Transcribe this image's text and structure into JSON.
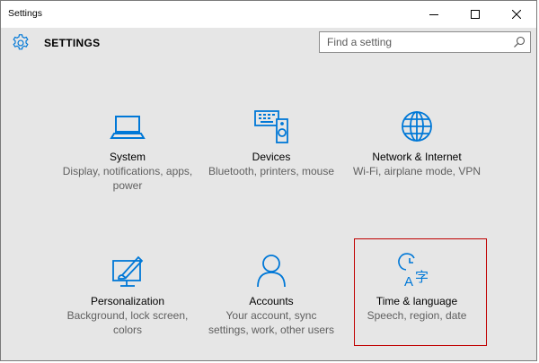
{
  "window": {
    "title": "Settings"
  },
  "header": {
    "heading": "SETTINGS",
    "gear_icon": "gear-icon"
  },
  "search": {
    "placeholder": "Find a setting",
    "icon": "search-icon"
  },
  "colors": {
    "accent": "#0078d7",
    "background": "#e6e6e6",
    "highlight_border": "#c00000"
  },
  "tiles": [
    {
      "label": "System",
      "desc": "Display, notifications, apps, power",
      "icon": "laptop-icon"
    },
    {
      "label": "Devices",
      "desc": "Bluetooth, printers, mouse",
      "icon": "devices-icon"
    },
    {
      "label": "Network & Internet",
      "desc": "Wi-Fi, airplane mode, VPN",
      "icon": "globe-icon"
    },
    {
      "label": "Personalization",
      "desc": "Background, lock screen, colors",
      "icon": "paint-icon"
    },
    {
      "label": "Accounts",
      "desc": "Your account, sync settings, work, other users",
      "icon": "person-icon"
    },
    {
      "label": "Time & language",
      "desc": "Speech, region, date",
      "icon": "time-language-icon"
    }
  ]
}
